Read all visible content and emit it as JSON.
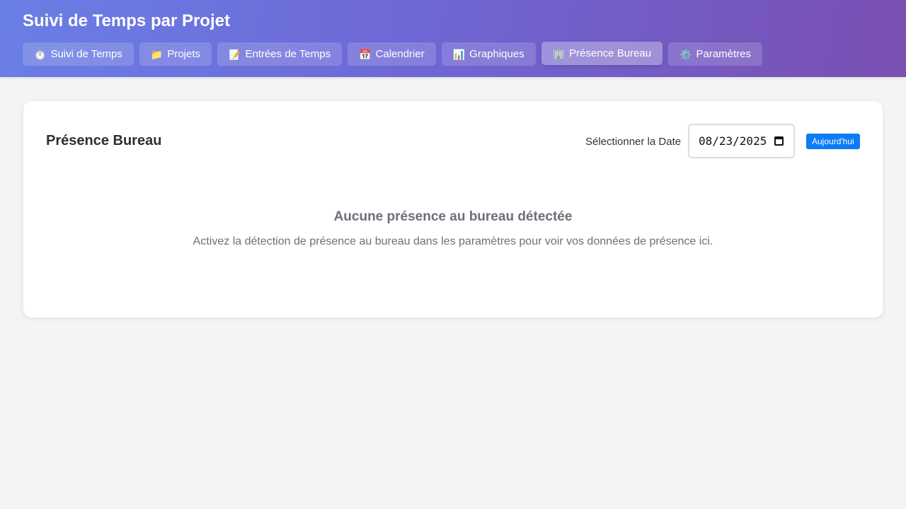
{
  "app": {
    "title": "Suivi de Temps par Projet"
  },
  "nav": {
    "tabs": [
      {
        "icon": "⏱️",
        "icon_name": "stopwatch-icon",
        "label": "Suivi de Temps"
      },
      {
        "icon": "📁",
        "icon_name": "folder-icon",
        "label": "Projets"
      },
      {
        "icon": "📝",
        "icon_name": "memo-icon",
        "label": "Entrées de Temps"
      },
      {
        "icon": "📅",
        "icon_name": "calendar-icon",
        "label": "Calendrier"
      },
      {
        "icon": "📊",
        "icon_name": "bar-chart-icon",
        "label": "Graphiques"
      },
      {
        "icon": "🏢",
        "icon_name": "office-building-icon",
        "label": "Présence Bureau",
        "active": true
      },
      {
        "icon": "⚙️",
        "icon_name": "gear-icon",
        "label": "Paramètres"
      }
    ]
  },
  "presence": {
    "title": "Présence Bureau",
    "date_label": "Sélectionner la Date",
    "date_value": "08/23/2025",
    "today_button": "Aujourd'hui",
    "empty_title": "Aucune présence au bureau détectée",
    "empty_text": "Activez la détection de présence au bureau dans les paramètres pour voir vos données de présence ici."
  },
  "colors": {
    "header_gradient_start": "#6a7fe6",
    "header_gradient_end": "#7a4fb1",
    "accent_button": "#0a7cf6",
    "page_background": "#f4f4f4"
  }
}
